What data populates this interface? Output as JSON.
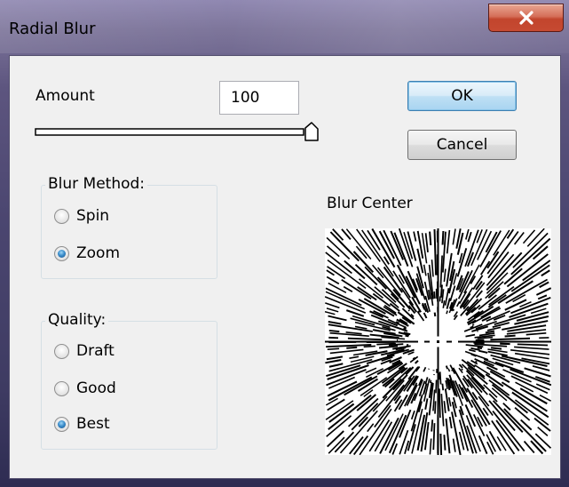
{
  "window": {
    "title": "Radial Blur",
    "close_icon": "close-icon"
  },
  "amount": {
    "label": "Amount",
    "value": "100",
    "slider_fraction": 1.0
  },
  "buttons": {
    "ok": "OK",
    "cancel": "Cancel"
  },
  "blur_method": {
    "legend": "Blur Method:",
    "options": [
      {
        "label": "Spin",
        "checked": false
      },
      {
        "label": "Zoom",
        "checked": true
      }
    ]
  },
  "quality": {
    "legend": "Quality:",
    "options": [
      {
        "label": "Draft",
        "checked": false
      },
      {
        "label": "Good",
        "checked": false
      },
      {
        "label": "Best",
        "checked": true
      }
    ]
  },
  "blur_center": {
    "label": "Blur Center"
  },
  "colors": {
    "accent": "#3c7fb1",
    "close": "#c7452e",
    "dialog_bg": "#f0f0f0"
  }
}
